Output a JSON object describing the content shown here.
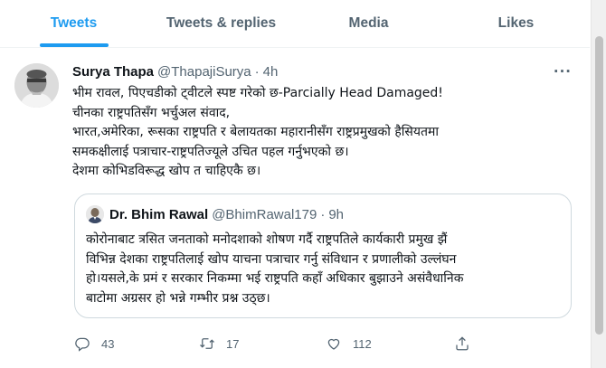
{
  "tabs": [
    {
      "label": "Tweets",
      "active": true
    },
    {
      "label": "Tweets & replies",
      "active": false
    },
    {
      "label": "Media",
      "active": false
    },
    {
      "label": "Likes",
      "active": false
    }
  ],
  "tweet": {
    "author_name": "Surya Thapa",
    "author_handle": "@ThapajiSurya",
    "separator": "·",
    "time": "4h",
    "more_icon": "more-icon",
    "lines": [
      "भीम रावल, पिएचडीको ट्वीटले स्पष्ट गरेको छ-Parcially Head Damaged!",
      "चीनका राष्ट्रपतिसँग भर्चुअल संवाद,",
      "भारत,अमेरिका, रूसका राष्ट्रपति र बेलायतका महारानीसँग राष्ट्रप्रमुखको हैसियतमा",
      "समकक्षीलाई पत्राचार-राष्ट्रपतिज्यूले उचित पहल गर्नुभएको छ।",
      "देशमा कोभिडविरूद्ध खोप त चाहिएकै छ।"
    ],
    "quote": {
      "author_name": "Dr. Bhim Rawal",
      "author_handle": "@BhimRawal179",
      "separator": "·",
      "time": "9h",
      "lines": [
        "कोरोनाबाट त्रसित जनताको मनोदशाको शोषण गर्दै राष्ट्रपतिले कार्यकारी प्रमुख झैं",
        "विभिन्न देशका राष्ट्रपतिलाई खोप याचना पत्राचार गर्नु संविधान र प्रणालीको उल्लंघन",
        "हो।यसले,के प्रमं र सरकार निकम्मा भई राष्ट्रपति कहाँ अधिकार बुझाउने असंवैधानिक",
        "बाटोमा अग्रसर हो भन्ने गम्भीर प्रश्न उठ्छ।"
      ]
    },
    "actions": {
      "replies": "43",
      "retweets": "17",
      "likes": "112"
    }
  },
  "colors": {
    "accent": "#1d9bf0",
    "muted": "#536471",
    "border": "#cfd9de"
  }
}
